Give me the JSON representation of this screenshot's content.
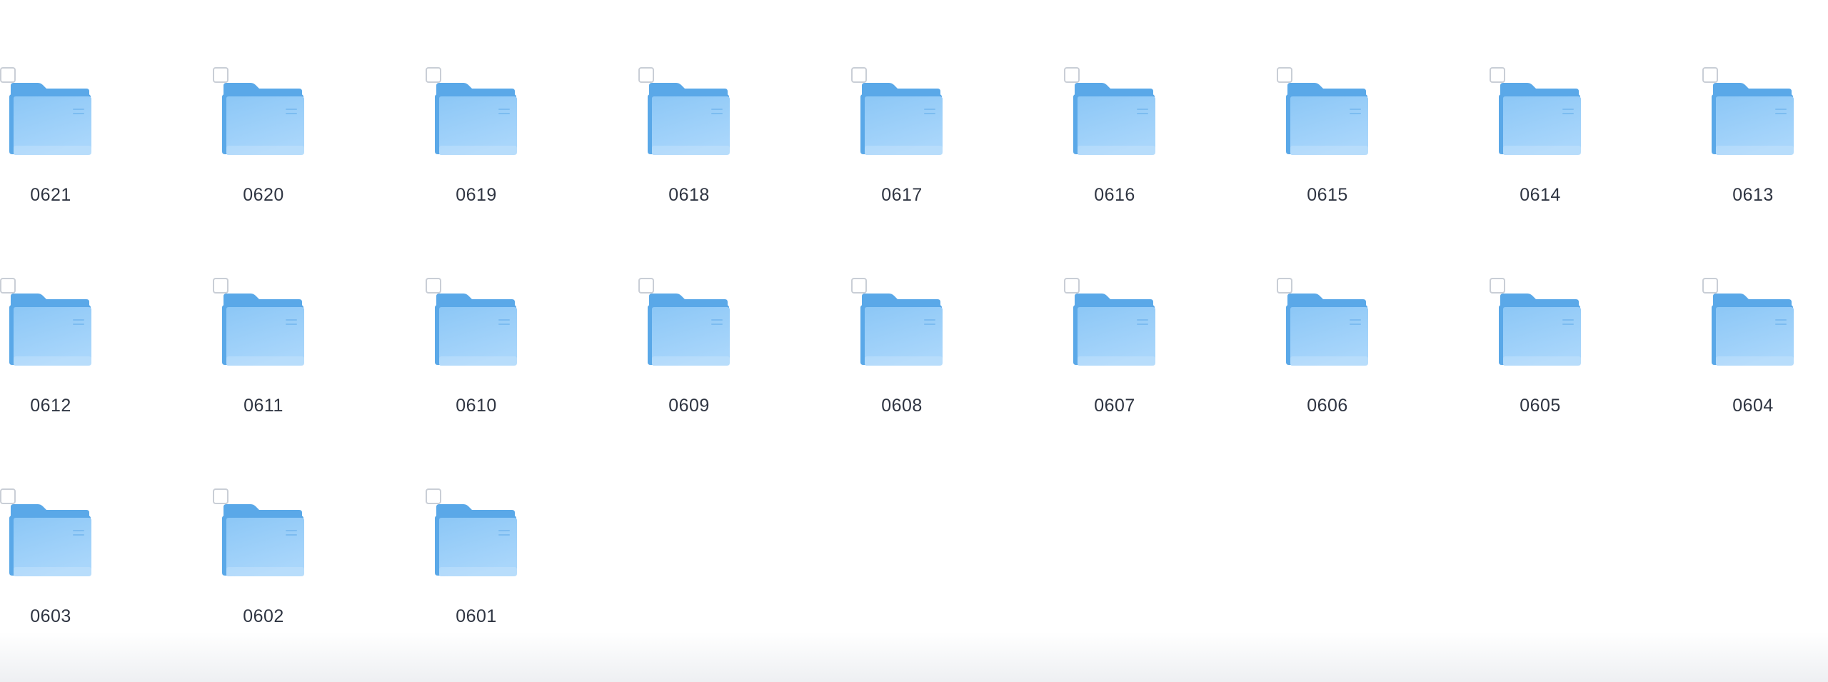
{
  "folders": [
    {
      "name": "0621"
    },
    {
      "name": "0620"
    },
    {
      "name": "0619"
    },
    {
      "name": "0618"
    },
    {
      "name": "0617"
    },
    {
      "name": "0616"
    },
    {
      "name": "0615"
    },
    {
      "name": "0614"
    },
    {
      "name": "0613"
    },
    {
      "name": "0612"
    },
    {
      "name": "0611"
    },
    {
      "name": "0610"
    },
    {
      "name": "0609"
    },
    {
      "name": "0608"
    },
    {
      "name": "0607"
    },
    {
      "name": "0606"
    },
    {
      "name": "0605"
    },
    {
      "name": "0604"
    },
    {
      "name": "0603"
    },
    {
      "name": "0602"
    },
    {
      "name": "0601"
    }
  ],
  "colors": {
    "folder_back": "#5aa8e8",
    "folder_front_top": "#8cc7f6",
    "folder_front_bottom": "#a9d6fb",
    "label_text": "#2f3542",
    "checkbox_border": "#c9ced6"
  },
  "icons": {
    "folder": "folder-icon",
    "checkbox": "checkbox-icon"
  }
}
